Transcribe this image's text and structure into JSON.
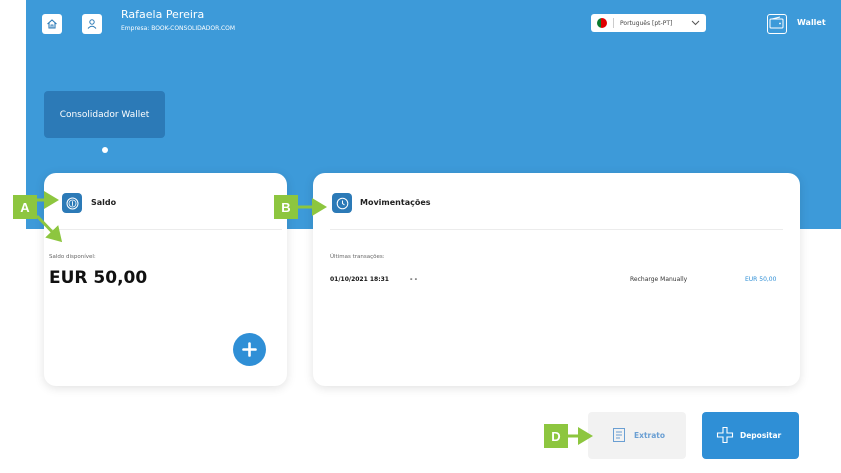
{
  "header": {
    "user_name": "Rafaela Pereira",
    "company": "Empresa: BOOK-CONSOLIDADOR.COM",
    "language": "Português [pt-PT]",
    "wallet_label": "Wallet"
  },
  "tabs": [
    {
      "label": "Consolidador Wallet"
    }
  ],
  "saldo": {
    "title": "Saldo",
    "available_label": "Saldo disponível:",
    "balance": "EUR 50,00"
  },
  "movimentacoes": {
    "title": "Movimentações",
    "recent_label": "Últimas transações:",
    "transactions": [
      {
        "date": "01/10/2021 18:31",
        "ref": "- -",
        "description": "Recharge Manually",
        "amount": "EUR 50,00"
      }
    ]
  },
  "actions": {
    "extrato_label": "Extrato",
    "depositar_label": "Depositar"
  },
  "annotations": {
    "a": "A",
    "b": "B",
    "d": "D"
  },
  "colors": {
    "primary": "#3d9ad9",
    "dark_blue": "#2c7ab7",
    "button_blue": "#2f8fd6",
    "annotation_green": "#8dc63f"
  },
  "icons": [
    "home-icon",
    "user-icon",
    "flag-icon",
    "chevron-down-icon",
    "wallet-icon",
    "coin-icon",
    "clock-icon",
    "plus-icon",
    "document-icon"
  ]
}
